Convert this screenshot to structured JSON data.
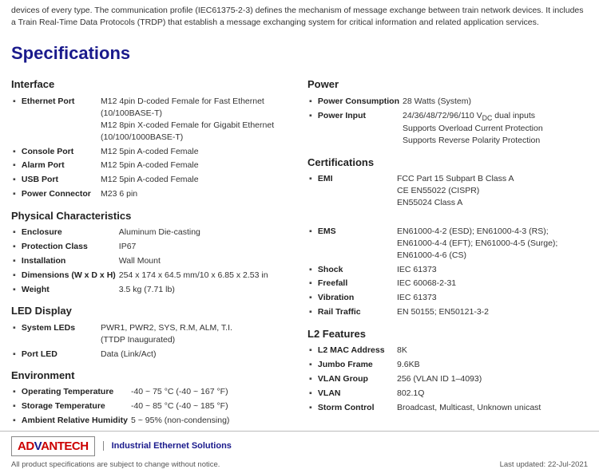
{
  "top_text": "devices of every type. The communication profile (IEC61375-2-3) defines the mechanism of message exchange between train network devices. It includes a Train Real-Time Data Protocols (TRDP) that establish a message exchanging system for critical information and related application services.",
  "specs_title": "Specifications",
  "sections": {
    "interface": {
      "title": "Interface",
      "rows": [
        {
          "bullet": "▪",
          "label": "Ethernet Port",
          "value": "M12 4pin D-coded Female for Fast Ethernet (10/100BASE-T)\nM12 8pin X-coded Female for Gigabit Ethernet (10/100/1000BASE-T)"
        },
        {
          "bullet": "",
          "label": "",
          "value": ""
        },
        {
          "bullet": "▪",
          "label": "Console Port",
          "value": "M12 5pin A-coded Female"
        },
        {
          "bullet": "▪",
          "label": "Alarm Port",
          "value": "M12 5pin A-coded Female"
        },
        {
          "bullet": "▪",
          "label": "USB Port",
          "value": "M12 5pin A-coded Female"
        },
        {
          "bullet": "▪",
          "label": "Power Connector",
          "value": "M23 6 pin"
        }
      ]
    },
    "physical": {
      "title": "Physical Characteristics",
      "rows": [
        {
          "bullet": "▪",
          "label": "Enclosure",
          "value": "Aluminum Die-casting"
        },
        {
          "bullet": "▪",
          "label": "Protection Class",
          "value": "IP67"
        },
        {
          "bullet": "▪",
          "label": "Installation",
          "value": "Wall Mount"
        },
        {
          "bullet": "▪",
          "label": "Dimensions (W x D x H)",
          "value": "254 x 174 x 64.5 mm/10 x 6.85 x 2.53 in"
        },
        {
          "bullet": "▪",
          "label": "Weight",
          "value": "3.5 kg (7.71 lb)"
        }
      ]
    },
    "led": {
      "title": "LED Display",
      "rows": [
        {
          "bullet": "▪",
          "label": "System LEDs",
          "value": "PWR1, PWR2, SYS, R.M, ALM, T.I. (TTDP Inaugurated)"
        },
        {
          "bullet": "",
          "label": "",
          "value": ""
        },
        {
          "bullet": "▪",
          "label": "Port LED",
          "value": "Data (Link/Act)"
        }
      ]
    },
    "environment": {
      "title": "Environment",
      "rows": [
        {
          "bullet": "▪",
          "label": "Operating Temperature",
          "value": "-40 ~ 75 °C (-40 ~ 167 °F)"
        },
        {
          "bullet": "▪",
          "label": "Storage Temperature",
          "value": "-40 ~ 85 °C (-40 ~ 185 °F)"
        },
        {
          "bullet": "▪",
          "label": "Ambient Relative Humidity",
          "value": "5 ~ 95% (non-condensing)"
        }
      ]
    },
    "power": {
      "title": "Power",
      "rows": [
        {
          "bullet": "▪",
          "label": "Power Consumption",
          "value": "28 Watts (System)"
        },
        {
          "bullet": "▪",
          "label": "Power Input",
          "value": "24/36/48/72/96/110 VDC dual inputs\nSupports Overload Current Protection\nSupports Reverse Polarity Protection"
        }
      ]
    },
    "certifications": {
      "title": "Certifications",
      "rows": [
        {
          "bullet": "▪",
          "label": "EMI",
          "value": "FCC Part 15 Subpart B Class A\nCE EN55022 (CISPR)\nEN55024 Class A"
        },
        {
          "bullet": "",
          "label": "",
          "value": ""
        },
        {
          "bullet": "▪",
          "label": "EMS",
          "value": "EN61000-4-2 (ESD); EN61000-4-3 (RS);\nEN61000-4-4 (EFT); EN61000-4-5 (Surge);\nEN61000-4-6 (CS)"
        },
        {
          "bullet": "▪",
          "label": "Shock",
          "value": "IEC 61373"
        },
        {
          "bullet": "▪",
          "label": "Freefall",
          "value": "IEC 60068-2-31"
        },
        {
          "bullet": "▪",
          "label": "Vibration",
          "value": "IEC 61373"
        },
        {
          "bullet": "▪",
          "label": "Rail Traffic",
          "value": "EN 50155; EN50121-3-2"
        }
      ]
    },
    "l2": {
      "title": "L2 Features",
      "rows": [
        {
          "bullet": "▪",
          "label": "L2 MAC Address",
          "value": "8K"
        },
        {
          "bullet": "▪",
          "label": "Jumbo Frame",
          "value": "9.6KB"
        },
        {
          "bullet": "▪",
          "label": "VLAN Group",
          "value": "256 (VLAN ID 1–4093)"
        },
        {
          "bullet": "▪",
          "label": "VLAN",
          "value": "802.1Q"
        },
        {
          "bullet": "▪",
          "label": "Storm Control",
          "value": "Broadcast, Multicast, Unknown unicast"
        }
      ]
    }
  },
  "footer": {
    "logo_ad": "AD",
    "logo_van": "V",
    "logo_tech": "ANTECH",
    "tagline": "Industrial Ethernet Solutions",
    "disclaimer": "All product specifications are subject to change without notice.",
    "updated": "Last updated: 22-Jul-2021"
  }
}
